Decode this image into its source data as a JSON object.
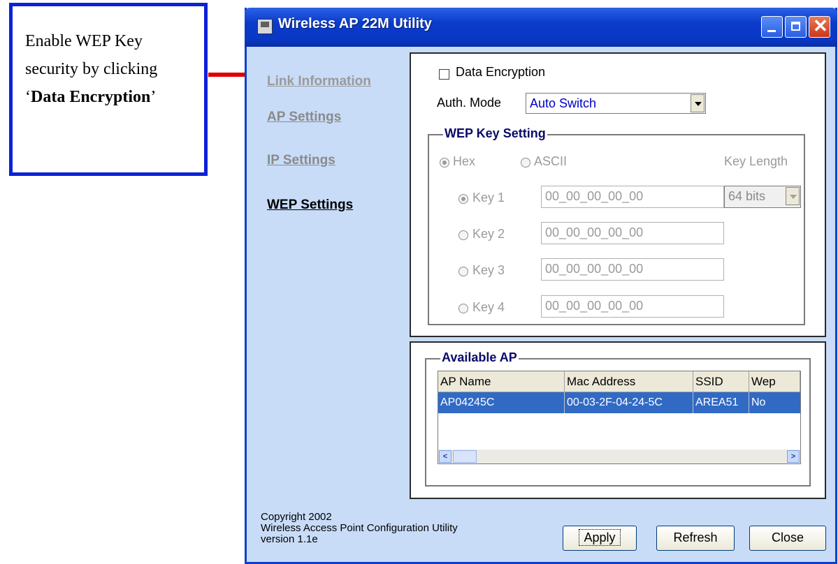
{
  "callout": {
    "line1": "Enable WEP Key",
    "line2": "security by clicking",
    "quote_open": "‘",
    "bold": "Data Encryption",
    "quote_close": "’"
  },
  "window": {
    "title": "Wireless AP 22M Utility"
  },
  "nav": {
    "items": [
      {
        "label": "Link Information"
      },
      {
        "label": "AP Settings"
      },
      {
        "label": "IP Settings"
      },
      {
        "label": "WEP Settings"
      }
    ]
  },
  "wep": {
    "data_encryption_label": "Data Encryption",
    "auth_mode_label": "Auth. Mode",
    "auth_mode_value": "Auto Switch",
    "group_title": "WEP Key Setting",
    "hex_label": "Hex",
    "ascii_label": "ASCII",
    "key_length_label": "Key Length",
    "key_length_value": "64 bits",
    "keys": [
      {
        "label": "Key 1",
        "value": "00_00_00_00_00"
      },
      {
        "label": "Key 2",
        "value": "00_00_00_00_00"
      },
      {
        "label": "Key 3",
        "value": "00_00_00_00_00"
      },
      {
        "label": "Key 4",
        "value": "00_00_00_00_00"
      }
    ]
  },
  "available_ap": {
    "title": "Available AP",
    "columns": [
      "AP Name",
      "Mac Address",
      "SSID",
      "Wep"
    ],
    "rows": [
      [
        "AP04245C",
        "00-03-2F-04-24-5C",
        "AREA51",
        "No"
      ]
    ]
  },
  "footer": {
    "copyright": "Copyright 2002",
    "product": "Wireless Access Point Configuration Utility",
    "version": "version 1.1e"
  },
  "buttons": {
    "apply": "Apply",
    "refresh": "Refresh",
    "close": "Close"
  },
  "colors": {
    "callout_border": "#0a22d8",
    "arrow": "#e00000",
    "titlebar": "#0a3ac8",
    "selection": "#316ac5"
  }
}
